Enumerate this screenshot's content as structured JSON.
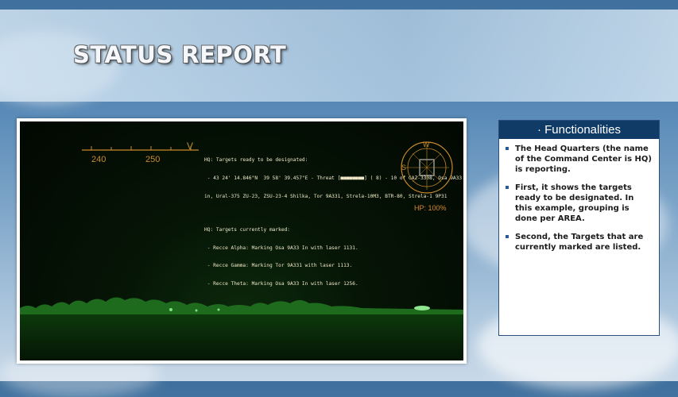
{
  "slide": {
    "title": "STATUS REPORT"
  },
  "screenshot": {
    "compass": {
      "ticks": [
        "240",
        "250"
      ],
      "marker": "V"
    },
    "hud_lines": [
      "HQ: Targets ready to be designated:",
      " - 43 24' 14.846\"N  39 58' 39.457\"E - Threat [■■■■■■■■] ( 8) - 10 of GAZ-3308, Osa 9A33",
      "in, Ural-375 ZU-23, ZSU-23-4 Shilka, Tor 9A331, Strela-10M3, BTR-80, Strela-1 9P31",
      "",
      "HQ: Targets currently marked:",
      " - Recce Alpha: Marking Osa 9A33 In with laser 1131.",
      " - Recce Gamma: Marking Tor 9A331 with laser 1113.",
      " - Recce Theta: Marking Osa 9A33 In with laser 1256."
    ],
    "hp_label": "HP: 100%",
    "dial_letters": {
      "top": "W",
      "left": "S"
    }
  },
  "panel": {
    "header": "· Functionalities",
    "items": [
      "The Head Quarters (the name of the Command Center is HQ) is reporting.",
      "First, it shows the targets ready to be designated. In this example, grouping is done per AREA.",
      "Second, the Targets that are currently marked are listed."
    ]
  },
  "colors": {
    "panel_header": "#0f3b66",
    "hud_orange": "#c98a2a",
    "hud_text": "#f0e9c8",
    "night_green": "#3aa83a"
  }
}
